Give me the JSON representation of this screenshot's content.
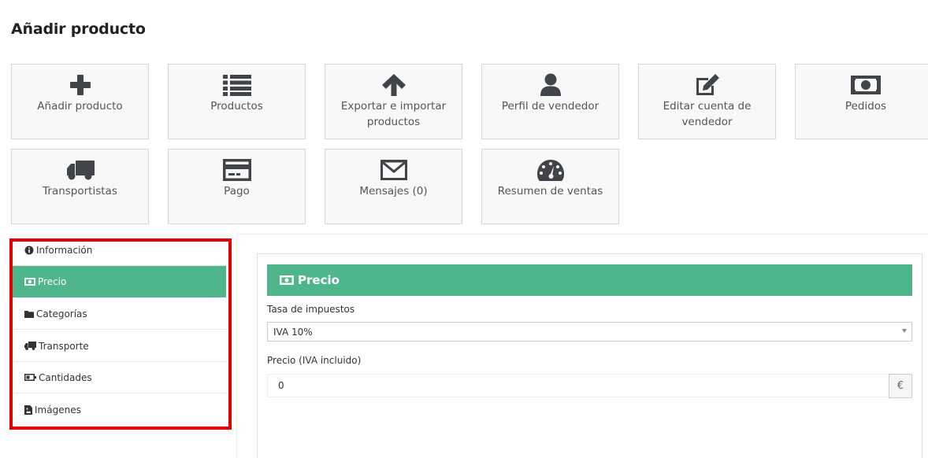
{
  "page_title": "Añadir producto",
  "tiles": [
    {
      "label": "Añadir producto",
      "icon": "plus-icon"
    },
    {
      "label": "Productos",
      "icon": "list-icon"
    },
    {
      "label": "Exportar e importar productos",
      "icon": "arrow-up-icon"
    },
    {
      "label": "Perfil de vendedor",
      "icon": "user-icon"
    },
    {
      "label": "Editar cuenta de vendedor",
      "icon": "edit-icon"
    },
    {
      "label": "Pedidos",
      "icon": "money-icon"
    },
    {
      "label": "Transportistas",
      "icon": "truck-icon"
    },
    {
      "label": "Pago",
      "icon": "credit-card-icon"
    },
    {
      "label": "Mensajes (0)",
      "icon": "envelope-icon"
    },
    {
      "label": "Resumen de ventas",
      "icon": "dashboard-icon"
    }
  ],
  "sidebar": {
    "items": [
      {
        "label": "Información",
        "icon": "info-circle-icon",
        "active": false
      },
      {
        "label": "Precio",
        "icon": "money-icon",
        "active": true
      },
      {
        "label": "Categorías",
        "icon": "folder-icon",
        "active": false
      },
      {
        "label": "Transporte",
        "icon": "truck-icon",
        "active": false
      },
      {
        "label": "Cantidades",
        "icon": "battery-icon",
        "active": false
      },
      {
        "label": "Imágenes",
        "icon": "file-image-icon",
        "active": false
      }
    ]
  },
  "panel": {
    "title": "Precio",
    "tax_label": "Tasa de impuestos",
    "tax_value": "IVA 10%",
    "price_label": "Precio (IVA incluido)",
    "price_value": "0",
    "currency": "€"
  },
  "colors": {
    "accent": "#4fb68b",
    "highlight_border": "#e00000"
  }
}
